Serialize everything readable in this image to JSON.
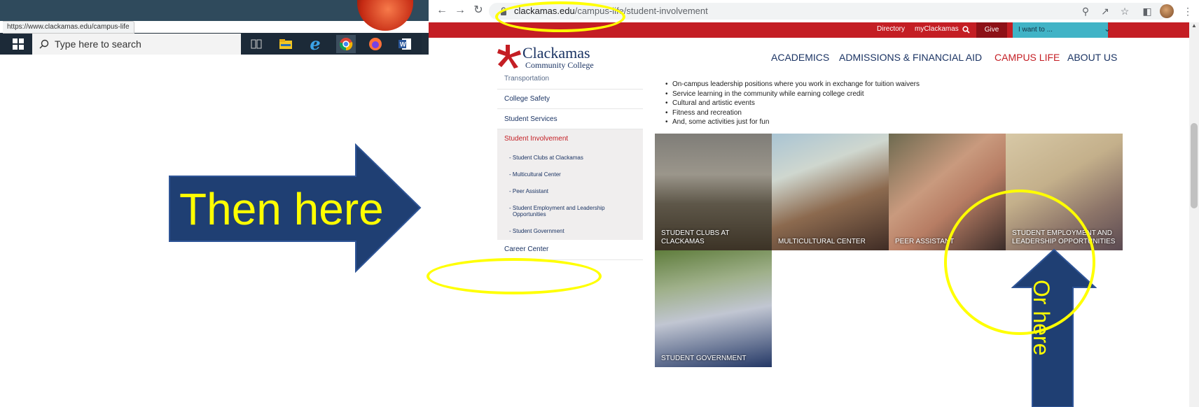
{
  "status_url": "https://www.clackamas.edu/campus-life",
  "taskbar": {
    "search_placeholder": "Type here to search"
  },
  "browser": {
    "url_domain": "clackamas.edu",
    "url_path": "/campus-life/student-involvement"
  },
  "utility_bar": {
    "directory": "Directory",
    "myclackamas": "myClackamas",
    "give": "Give",
    "i_want_to": "I want to ..."
  },
  "logo": {
    "title": "Clackamas",
    "subtitle": "Community College"
  },
  "main_nav": [
    "ACADEMICS",
    "ADMISSIONS & FINANCIAL AID",
    "CAMPUS LIFE",
    "ABOUT US"
  ],
  "sidebar": {
    "items": [
      {
        "label": "Transportation"
      },
      {
        "label": "College Safety"
      },
      {
        "label": "Student Services"
      },
      {
        "label": "Student Involvement"
      },
      {
        "label": "Career Center"
      }
    ],
    "subitems": [
      {
        "label": "- Student Clubs at Clackamas"
      },
      {
        "label": "- Multicultural Center"
      },
      {
        "label": "- Peer Assistant"
      },
      {
        "label": "- Student Employment and Leadership"
      },
      {
        "label": "Opportunities"
      },
      {
        "label": "- Student Government"
      }
    ]
  },
  "bullets": [
    "On-campus leadership positions where you work in exchange for tuition waivers",
    "Service learning in the community while earning college credit",
    "Cultural and artistic events",
    "Fitness and recreation",
    "And, some activities just for fun"
  ],
  "tiles": [
    {
      "line1": "STUDENT CLUBS AT",
      "line2": "CLACKAMAS"
    },
    {
      "line1": "",
      "line2": "MULTICULTURAL CENTER"
    },
    {
      "line1": "",
      "line2": "PEER ASSISTANT"
    },
    {
      "line1": "STUDENT EMPLOYMENT AND",
      "line2": "LEADERSHIP OPPORTUNITIES"
    },
    {
      "line1": "",
      "line2": "STUDENT GOVERNMENT"
    }
  ],
  "annotations": {
    "then_here": "Then here",
    "or_here": "Or here"
  },
  "colors": {
    "brand_red": "#c41e24",
    "brand_navy": "#1b3464",
    "annotation_yellow": "#ffff00",
    "arrow_blue": "#1f3f73"
  }
}
